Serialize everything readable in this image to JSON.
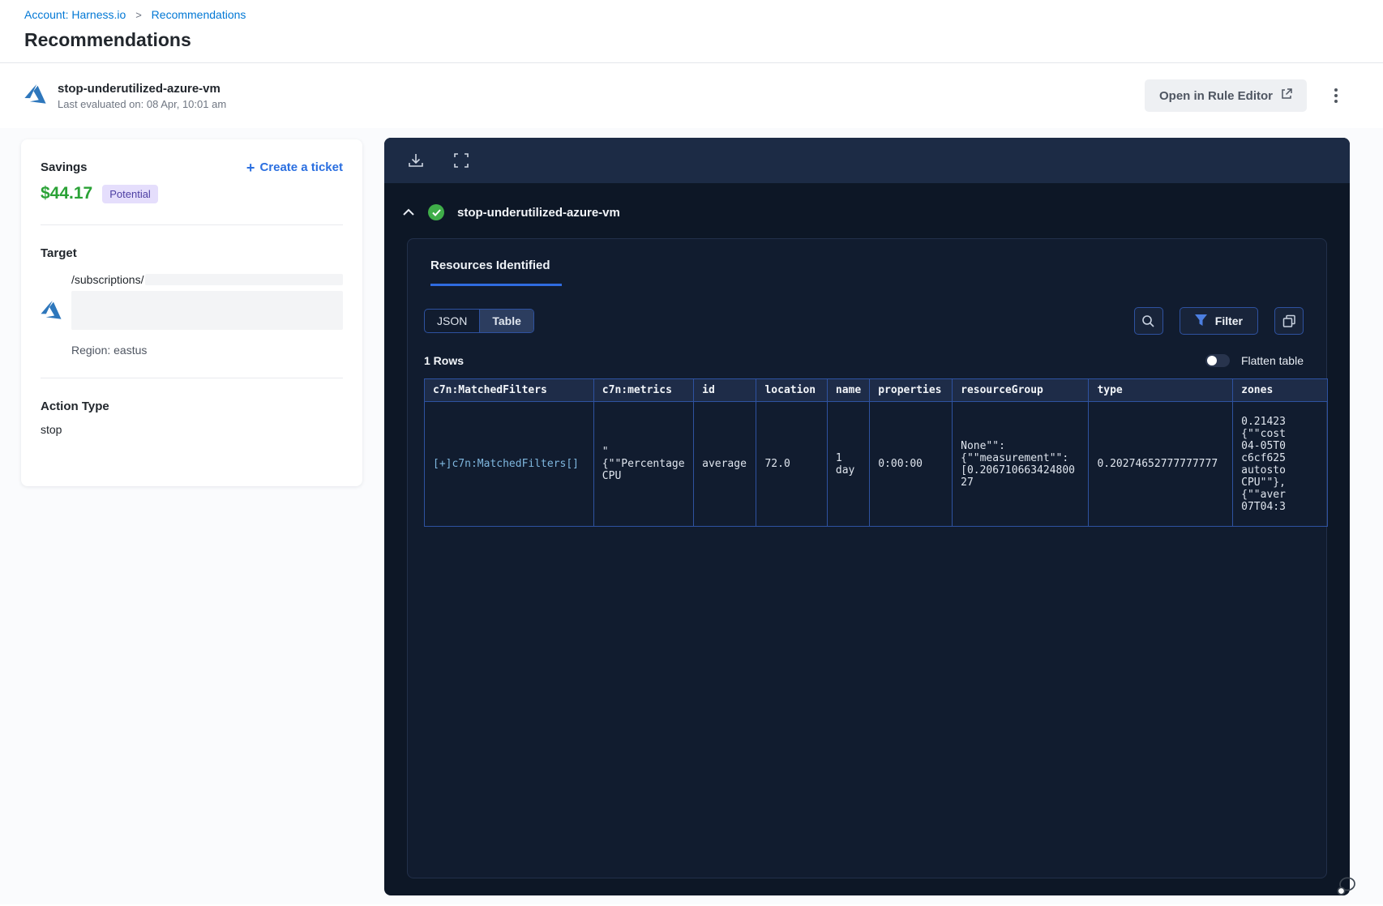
{
  "breadcrumb": {
    "account": "Account: Harness.io",
    "separator": ">",
    "current": "Recommendations"
  },
  "page_title": "Recommendations",
  "rec_header": {
    "title": "stop-underutilized-azure-vm",
    "subtitle": "Last evaluated on: 08 Apr, 10:01 am",
    "open_rule_editor_label": "Open in Rule Editor"
  },
  "summary_card": {
    "savings_label": "Savings",
    "savings_amount": "$44.17",
    "savings_badge": "Potential",
    "create_ticket_label": "Create a ticket",
    "target_label": "Target",
    "target_path": "/subscriptions/",
    "region": "Region: eastus",
    "action_type_label": "Action Type",
    "action_type_value": "stop"
  },
  "panel": {
    "rule_title": "stop-underutilized-azure-vm",
    "tab_label": "Resources Identified",
    "view_toggle": {
      "json_label": "JSON",
      "table_label": "Table",
      "selected": "Table"
    },
    "filter_label": "Filter",
    "rows_count": "1 Rows",
    "flatten_label": "Flatten table",
    "table": {
      "headers": [
        "c7n:MatchedFilters",
        "c7n:metrics",
        "id",
        "location",
        "name",
        "properties",
        "resourceGroup",
        "type",
        "zones"
      ],
      "row": {
        "matched_filters": "[+]c7n:MatchedFilters[]",
        "metrics": "\"\n{\"\"Percentage\nCPU",
        "id": "average",
        "location": "72.0",
        "name": "1\nday",
        "properties": "0:00:00",
        "resource_group": "None\"\":\n{\"\"measurement\"\":\n[0.20671066342480027",
        "type": "0.20274652777777777",
        "zones": "0.21423\n{\"\"cost\n04-05T0\nc6cf625\nautosto\nCPU\"\"},\n{\"\"aver\n07T04:3"
      }
    }
  },
  "colors": {
    "accent_blue": "#0278d5",
    "link_blue": "#2b6fe0",
    "savings_green": "#2aa236",
    "badge_bg": "#e5defc",
    "badge_text": "#4d3fa3",
    "panel_bg": "#0d1726",
    "panel_toolbar_bg": "#1c2b45",
    "inner_card_bg": "#111c2f",
    "table_border_blue": "#2e52a0",
    "table_header_bg": "#1e2c48",
    "cell_link_blue": "#7fb7df",
    "check_green": "#3fae49",
    "filter_icon_blue": "#4c7fe1"
  }
}
